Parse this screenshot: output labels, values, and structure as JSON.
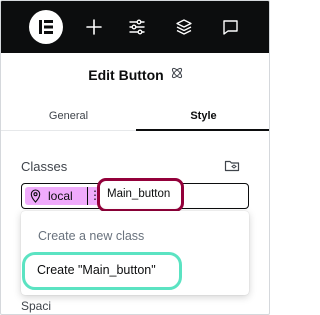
{
  "topbar": {
    "icons": [
      "elementor-logo-icon",
      "plus-icon",
      "sliders-icon",
      "layers-icon",
      "chat-icon"
    ]
  },
  "header": {
    "title": "Edit Button",
    "title_icon": "atomic-icon"
  },
  "tabs": [
    {
      "label": "General",
      "active": false
    },
    {
      "label": "Style",
      "active": true
    }
  ],
  "classes": {
    "label": "Classes",
    "chip": {
      "icon": "location-pin-icon",
      "label": "local",
      "menu": "⋮"
    },
    "input_value": "Main_button"
  },
  "dropdown": {
    "heading": "Create a new class",
    "option": "Create \"Main_button\""
  },
  "below": {
    "section_label": "Spacing"
  },
  "colors": {
    "chip_bg": "#f0abfc",
    "typed_highlight": "#93003a",
    "option_highlight": "#5be3c2",
    "topbar_bg": "#0c0d0e"
  }
}
